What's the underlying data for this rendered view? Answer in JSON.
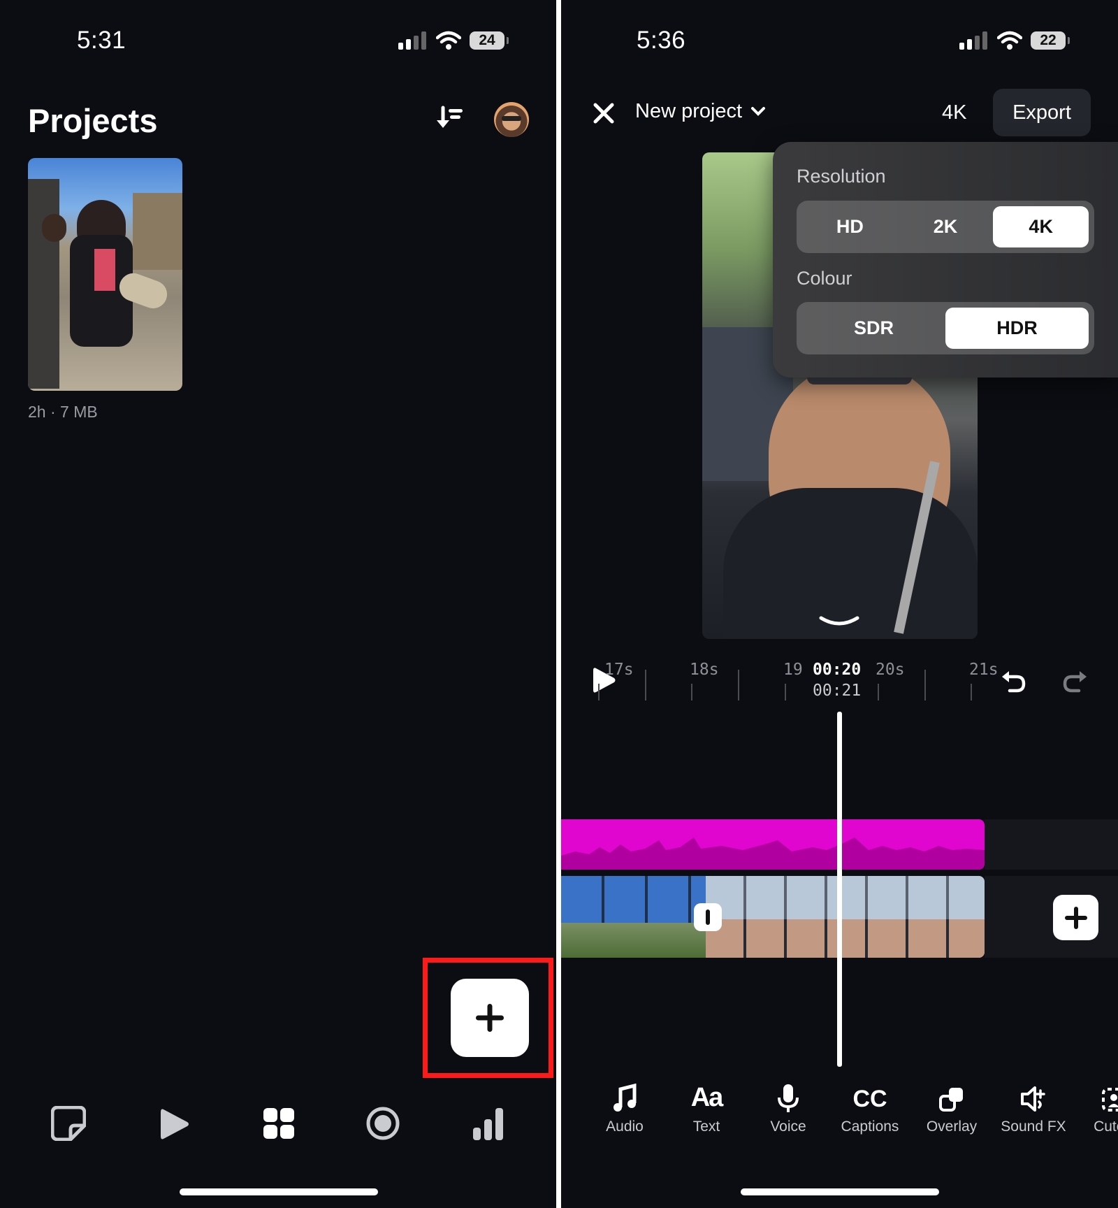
{
  "left": {
    "status": {
      "time": "5:31",
      "battery": "24"
    },
    "header": {
      "title": "Projects"
    },
    "project": {
      "meta": "2h · 7 MB"
    },
    "fab_label": "+"
  },
  "right": {
    "status": {
      "time": "5:36",
      "battery": "22"
    },
    "header": {
      "title": "New project",
      "resolution": "4K",
      "export": "Export"
    },
    "popover": {
      "resolution_label": "Resolution",
      "resolution_options": [
        "HD",
        "2K",
        "4K"
      ],
      "resolution_selected": "4K",
      "colour_label": "Colour",
      "colour_options": [
        "SDR",
        "HDR"
      ],
      "colour_selected": "HDR"
    },
    "timeline": {
      "ruler": [
        "17s",
        "18s",
        "19s",
        "20s",
        "21s"
      ],
      "current": "00:20",
      "total": "00:21"
    },
    "tools": [
      "Audio",
      "Text",
      "Voice",
      "Captions",
      "Overlay",
      "Sound FX",
      "Cutout"
    ]
  },
  "colors": {
    "background": "#0b0d12",
    "audio_track": "#e005cf",
    "highlight_box": "#ff1a1a"
  }
}
